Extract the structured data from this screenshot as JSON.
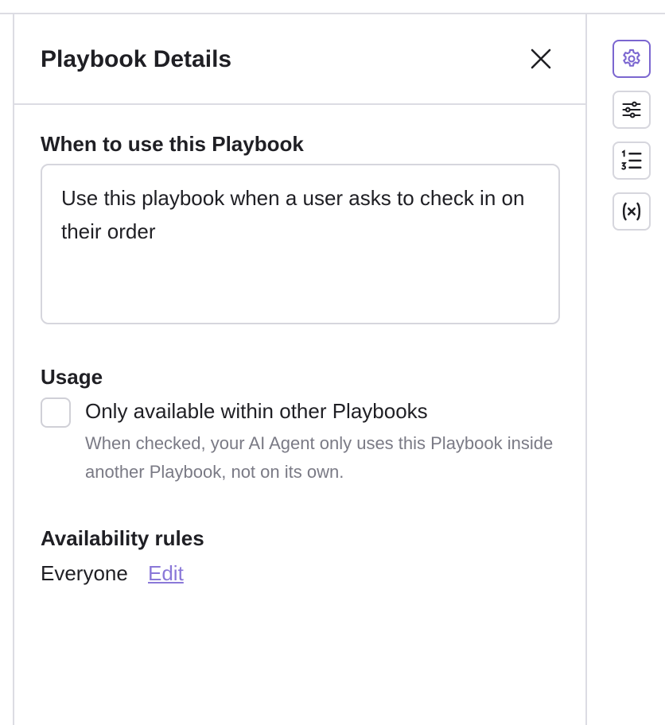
{
  "panel": {
    "title": "Playbook Details",
    "when_label": "When to use this Playbook",
    "when_value": "Use this playbook when a user asks to check in on their order",
    "usage_label": "Usage",
    "usage_checkbox_label": "Only available within other Playbooks",
    "usage_helper": "When checked, your AI Agent only uses this Playbook inside another Playbook, not on its own.",
    "usage_checked": false,
    "availability_label": "Availability rules",
    "availability_value": "Everyone",
    "edit_label": "Edit"
  },
  "rail": {
    "items": [
      {
        "icon": "gear-icon",
        "active": true
      },
      {
        "icon": "sliders-icon",
        "active": false
      },
      {
        "icon": "numbered-list-icon",
        "active": false
      },
      {
        "icon": "variable-icon",
        "active": false
      }
    ]
  },
  "colors": {
    "accent": "#7b66d0",
    "link": "#8a78d8",
    "border": "#dcdce3",
    "muted_text": "#7a7a85"
  }
}
